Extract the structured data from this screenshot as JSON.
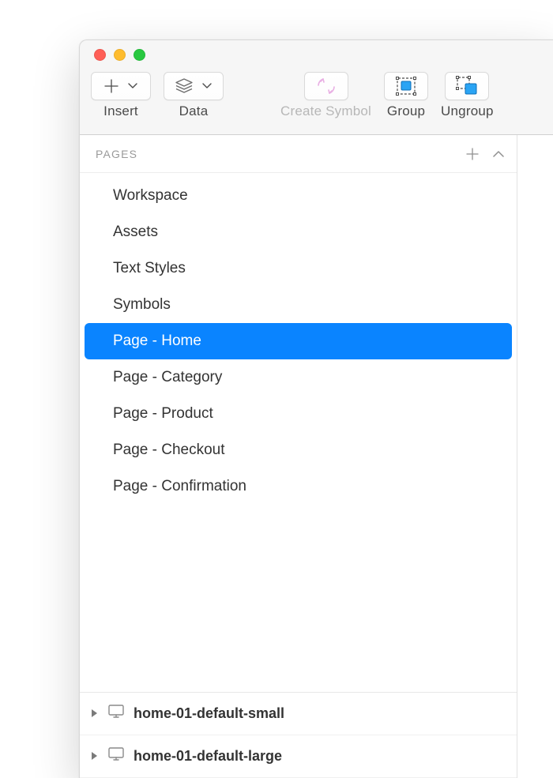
{
  "toolbar": {
    "insert_label": "Insert",
    "data_label": "Data",
    "create_symbol_label": "Create Symbol",
    "group_label": "Group",
    "ungroup_label": "Ungroup"
  },
  "sidebar": {
    "pages_heading": "PAGES",
    "pages": [
      {
        "label": "Workspace",
        "selected": false
      },
      {
        "label": "Assets",
        "selected": false
      },
      {
        "label": "Text Styles",
        "selected": false
      },
      {
        "label": "Symbols",
        "selected": false
      },
      {
        "label": "Page - Home",
        "selected": true
      },
      {
        "label": "Page - Category",
        "selected": false
      },
      {
        "label": "Page - Product",
        "selected": false
      },
      {
        "label": "Page - Checkout",
        "selected": false
      },
      {
        "label": "Page - Confirmation",
        "selected": false
      }
    ],
    "artboards": [
      {
        "label": "home-01-default-small"
      },
      {
        "label": "home-01-default-large"
      }
    ]
  }
}
